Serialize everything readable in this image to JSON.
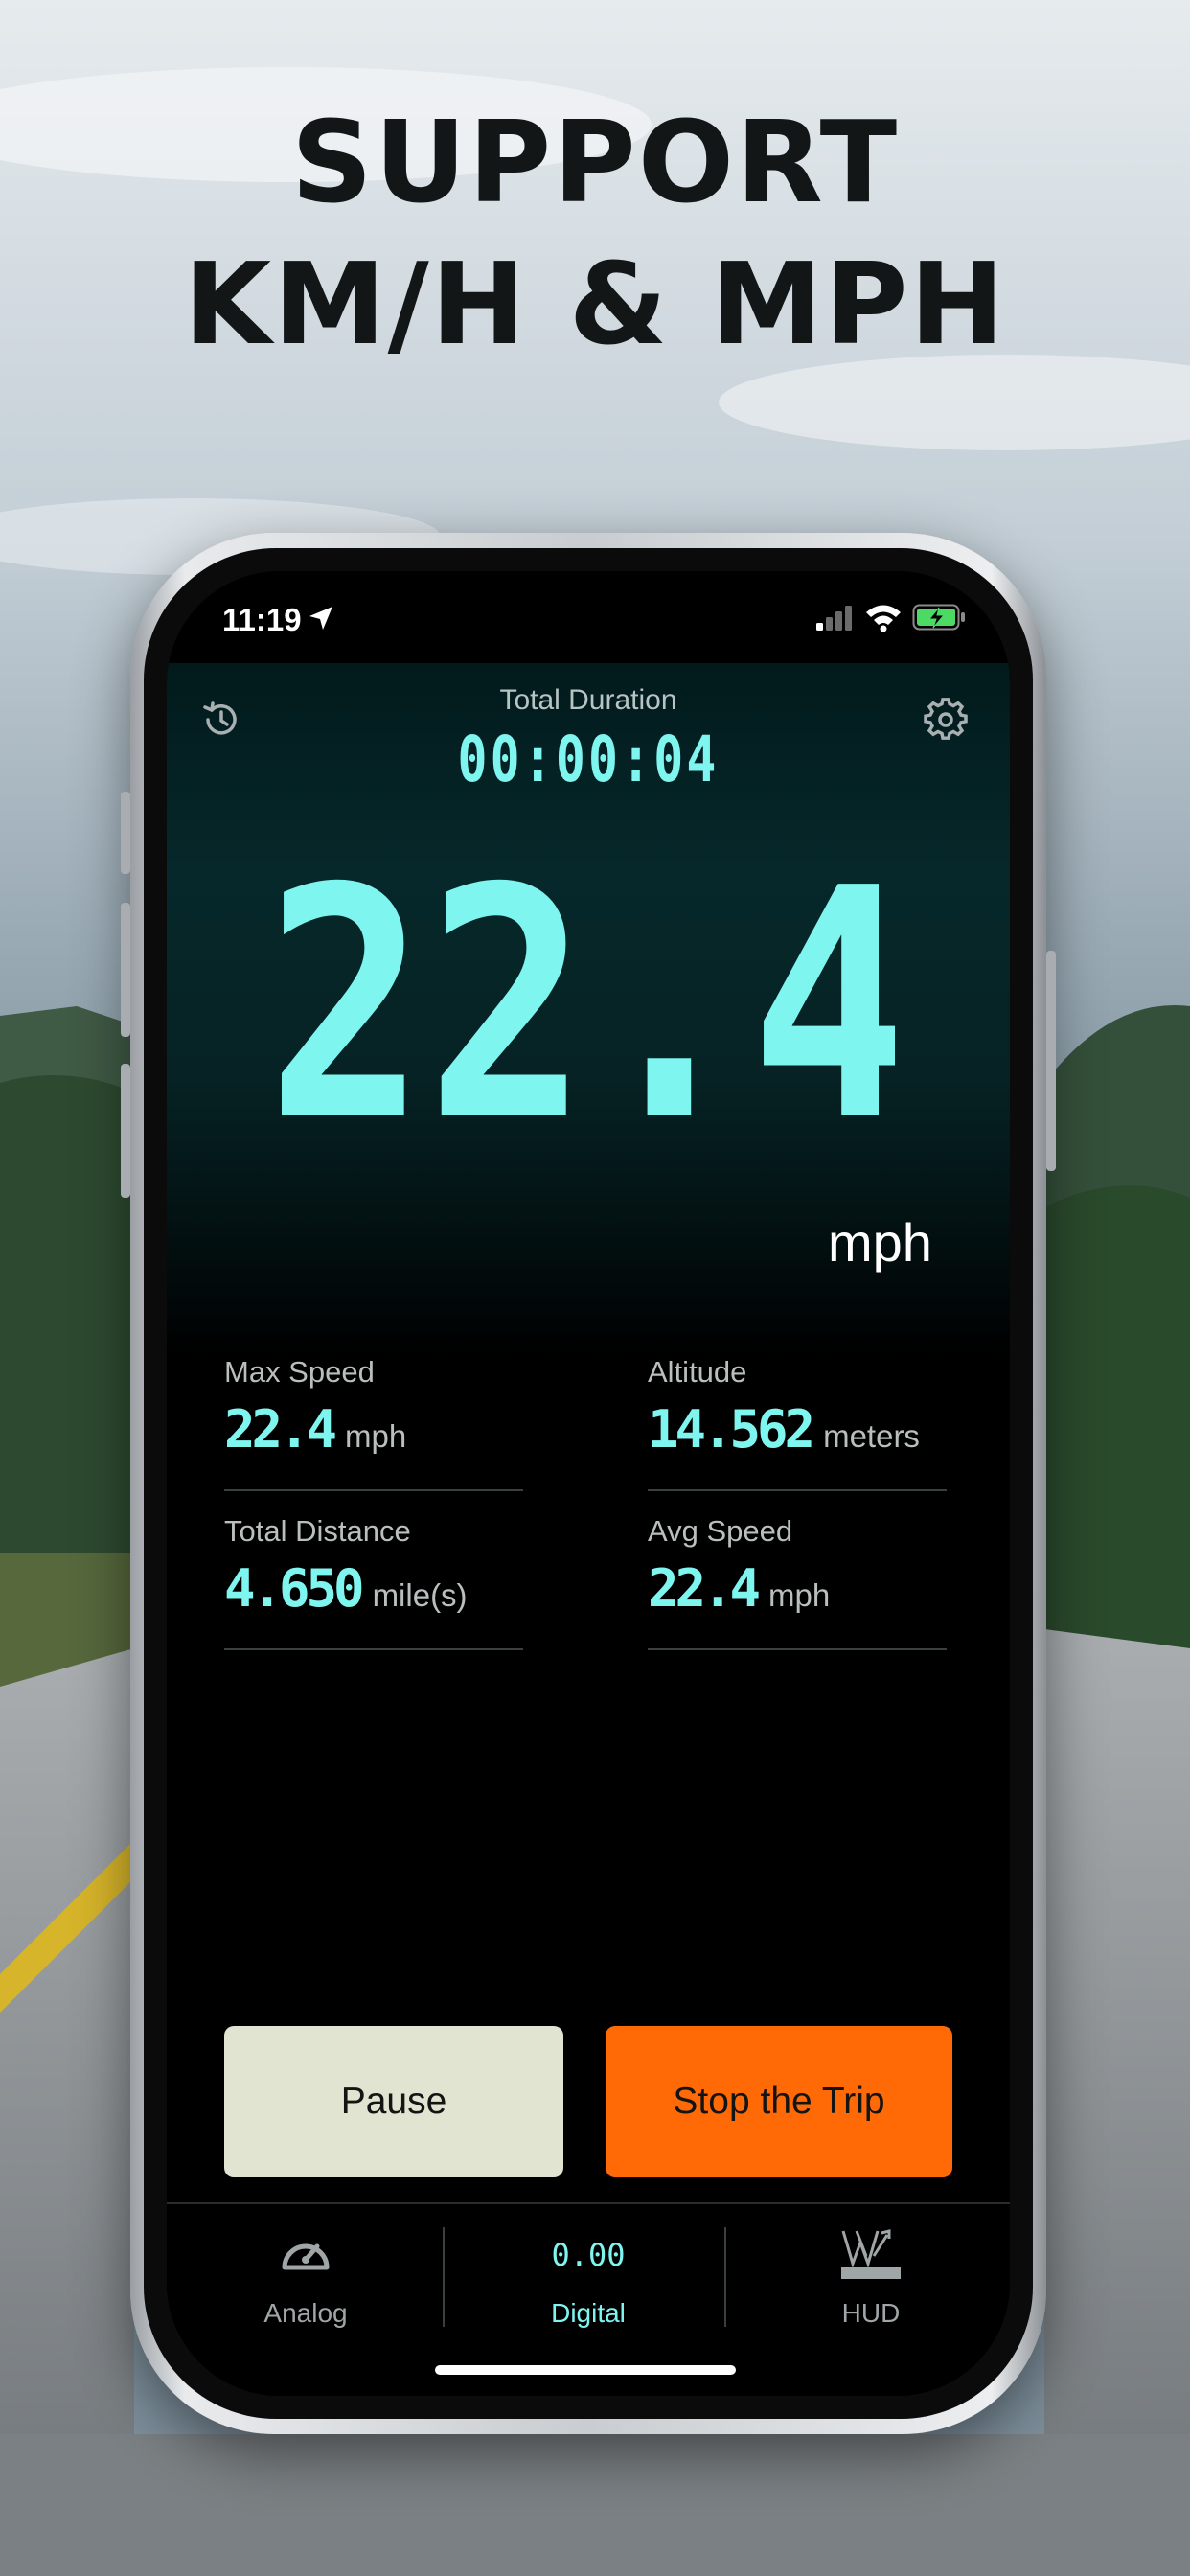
{
  "headline": {
    "line1": "SUPPORT",
    "line2": "KM/H & MPH"
  },
  "status_bar": {
    "time": "11:19"
  },
  "trip": {
    "duration_label": "Total Duration",
    "duration_value": "00:00:04",
    "current_speed": "22.4",
    "speed_unit": "mph"
  },
  "stats": [
    {
      "label": "Max Speed",
      "value": "22.4",
      "unit": "mph"
    },
    {
      "label": "Altitude",
      "value": "14.562",
      "unit": "meters"
    },
    {
      "label": "Total Distance",
      "value": "4.650",
      "unit": "mile(s)"
    },
    {
      "label": "Avg Speed",
      "value": "22.4",
      "unit": "mph"
    }
  ],
  "actions": {
    "pause_label": "Pause",
    "stop_label": "Stop the Trip"
  },
  "tabs": [
    {
      "label": "Analog",
      "icon": "speedometer-icon",
      "active": false
    },
    {
      "label": "Digital",
      "icon_text": "0.00",
      "icon": "digital-readout-icon",
      "active": true
    },
    {
      "label": "HUD",
      "icon": "hud-icon",
      "active": false
    }
  ],
  "colors": {
    "accent_cyan": "#7ff5f0",
    "stop_orange": "#ff6a06",
    "pause_beige": "#e1e4d1",
    "battery_green": "#4cd964"
  }
}
